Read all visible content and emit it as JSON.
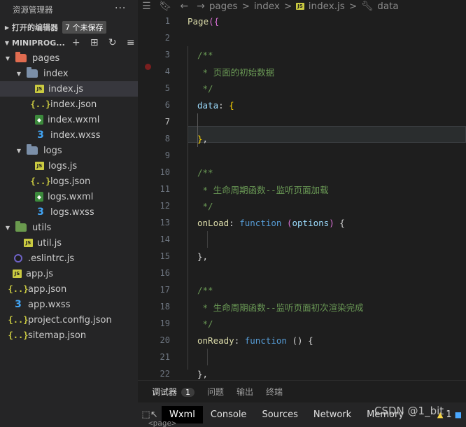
{
  "sidebar": {
    "title": "资源管理器",
    "more_label": "···",
    "open_editors": {
      "label": "打开的编辑器",
      "unsaved": "7 个未保存"
    },
    "project": {
      "label": "MINIPROG..."
    },
    "tree": [
      {
        "name": "pages",
        "type": "folder",
        "color": "red",
        "depth": 1,
        "expanded": true
      },
      {
        "name": "index",
        "type": "folder",
        "color": "blue",
        "depth": 2,
        "expanded": true
      },
      {
        "name": "index.js",
        "type": "js",
        "depth": 3,
        "selected": true
      },
      {
        "name": "index.json",
        "type": "json",
        "depth": 3
      },
      {
        "name": "index.wxml",
        "type": "wxml",
        "depth": 3
      },
      {
        "name": "index.wxss",
        "type": "wxss",
        "depth": 3
      },
      {
        "name": "logs",
        "type": "folder",
        "color": "blue",
        "depth": 2,
        "expanded": true
      },
      {
        "name": "logs.js",
        "type": "js",
        "depth": 3
      },
      {
        "name": "logs.json",
        "type": "json",
        "depth": 3
      },
      {
        "name": "logs.wxml",
        "type": "wxml",
        "depth": 3
      },
      {
        "name": "logs.wxss",
        "type": "wxss",
        "depth": 3
      },
      {
        "name": "utils",
        "type": "folder",
        "color": "green",
        "depth": 1,
        "expanded": true
      },
      {
        "name": "util.js",
        "type": "js",
        "depth": 2
      },
      {
        "name": ".eslintrc.js",
        "type": "eslint",
        "depth": 1
      },
      {
        "name": "app.js",
        "type": "js",
        "depth": 1
      },
      {
        "name": "app.json",
        "type": "json",
        "depth": 1
      },
      {
        "name": "app.wxss",
        "type": "wxss",
        "depth": 1
      },
      {
        "name": "project.config.json",
        "type": "json",
        "depth": 1
      },
      {
        "name": "sitemap.json",
        "type": "json",
        "depth": 1
      }
    ]
  },
  "breadcrumb": {
    "items": [
      "pages",
      "index",
      "index.js",
      "data"
    ]
  },
  "editor": {
    "current_line": 7,
    "lines": [
      {
        "n": "1",
        "tokens": [
          [
            "fn",
            "Page"
          ],
          [
            "par",
            "({"
          ]
        ]
      },
      {
        "n": "2",
        "tokens": []
      },
      {
        "n": "3",
        "tokens": [
          [
            "cm",
            "/**"
          ]
        ]
      },
      {
        "n": "4",
        "tokens": [
          [
            "cm",
            " * 页面的初始数据"
          ]
        ]
      },
      {
        "n": "5",
        "tokens": [
          [
            "cm",
            " */"
          ]
        ]
      },
      {
        "n": "6",
        "tokens": [
          [
            "prop",
            "data"
          ],
          [
            "pl",
            ": "
          ],
          [
            "br",
            "{"
          ]
        ]
      },
      {
        "n": "7",
        "tokens": []
      },
      {
        "n": "8",
        "tokens": [
          [
            "br",
            "}"
          ],
          [
            "pl",
            ","
          ]
        ]
      },
      {
        "n": "9",
        "tokens": []
      },
      {
        "n": "10",
        "tokens": [
          [
            "cm",
            "/**"
          ]
        ]
      },
      {
        "n": "11",
        "tokens": [
          [
            "cm",
            " * 生命周期函数--监听页面加载"
          ]
        ]
      },
      {
        "n": "12",
        "tokens": [
          [
            "cm",
            " */"
          ]
        ]
      },
      {
        "n": "13",
        "tokens": [
          [
            "key",
            "onLoad"
          ],
          [
            "pl",
            ": "
          ],
          [
            "kw",
            "function"
          ],
          [
            "pl",
            " "
          ],
          [
            "par",
            "("
          ],
          [
            "opt",
            "options"
          ],
          [
            "par",
            ")"
          ],
          [
            "pl",
            " {"
          ]
        ]
      },
      {
        "n": "14",
        "tokens": []
      },
      {
        "n": "15",
        "tokens": [
          [
            "pl",
            "},"
          ]
        ]
      },
      {
        "n": "16",
        "tokens": []
      },
      {
        "n": "17",
        "tokens": [
          [
            "cm",
            "/**"
          ]
        ]
      },
      {
        "n": "18",
        "tokens": [
          [
            "cm",
            " * 生命周期函数--监听页面初次渲染完成"
          ]
        ]
      },
      {
        "n": "19",
        "tokens": [
          [
            "cm",
            " */"
          ]
        ]
      },
      {
        "n": "20",
        "tokens": [
          [
            "key",
            "onReady"
          ],
          [
            "pl",
            ": "
          ],
          [
            "kw",
            "function"
          ],
          [
            "pl",
            " () {"
          ]
        ]
      },
      {
        "n": "21",
        "tokens": []
      },
      {
        "n": "22",
        "tokens": [
          [
            "pl",
            "},"
          ]
        ]
      }
    ]
  },
  "panel": {
    "tabs": [
      {
        "label": "调试器",
        "count": "1",
        "active": true
      },
      {
        "label": "问题"
      },
      {
        "label": "输出"
      },
      {
        "label": "终端"
      }
    ]
  },
  "devtools": {
    "tabs": [
      "Wxml",
      "Console",
      "Sources",
      "Network",
      "Memory"
    ],
    "active_tab": "Wxml",
    "warn_count": "1",
    "page_tag": "<page>"
  },
  "watermark": "CSDN @1_bit",
  "colors": {
    "background": "#1e1e1e",
    "sidebar": "#252526",
    "selection": "#37373d",
    "comment": "#6a9955",
    "keyword": "#569cd6"
  }
}
